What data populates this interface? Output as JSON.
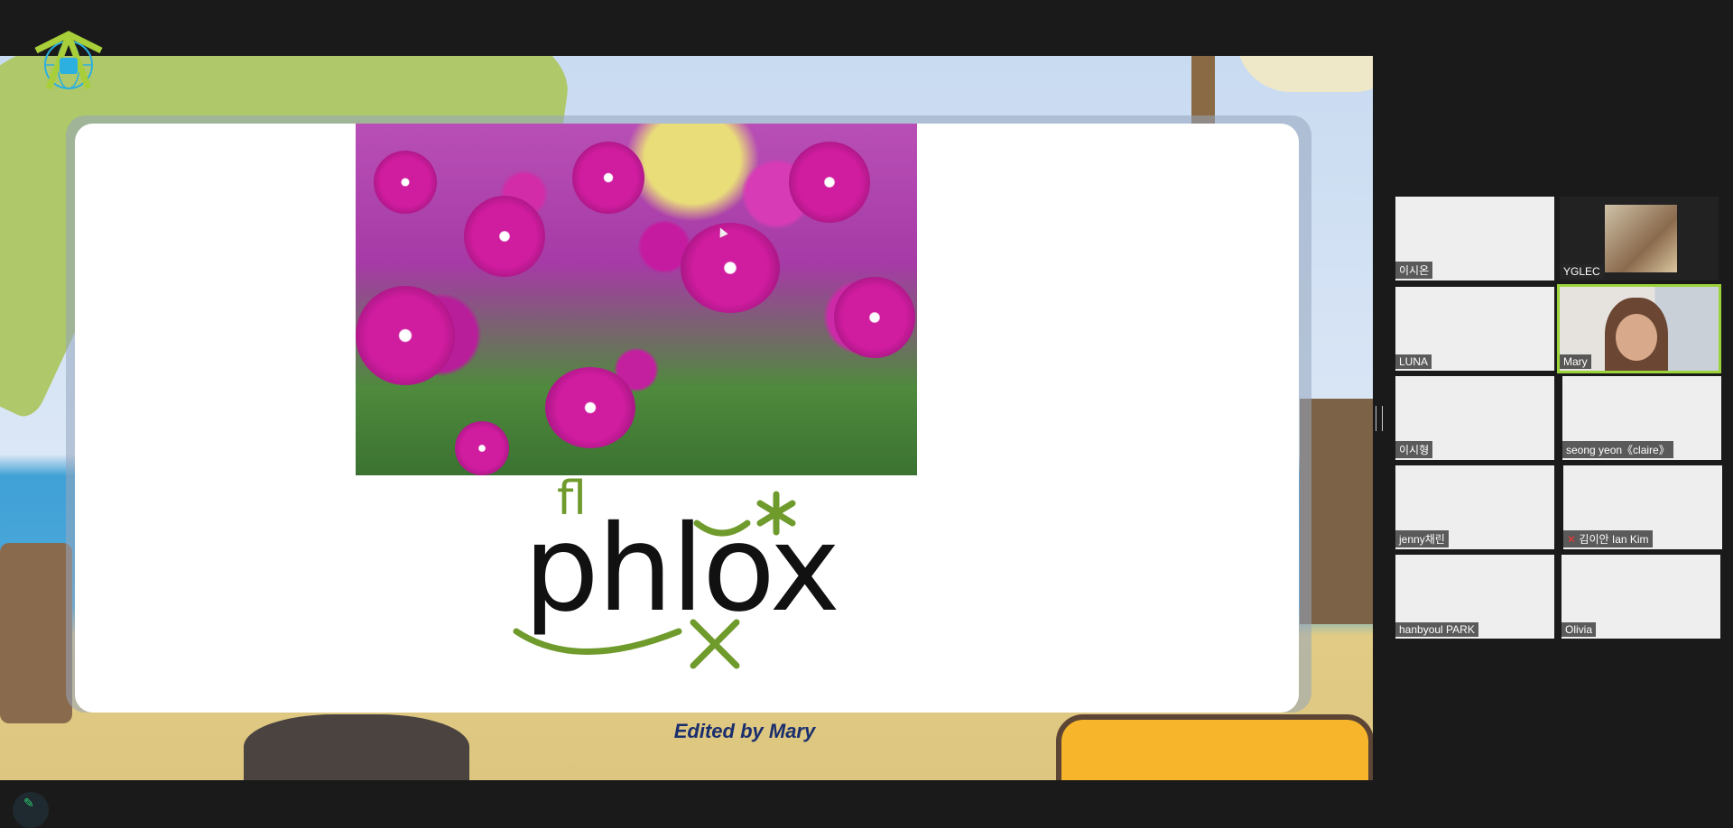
{
  "share_screen": {
    "slide": {
      "image_alt": "purple phlox flowers",
      "word": "phlox",
      "sound_hint": "fl",
      "caption": "Edited by Mary"
    },
    "company_logo": "globe-e-logo-icon"
  },
  "colors": {
    "accent_green": "#6f9a2c",
    "active_speaker": "#9bd33a",
    "caption": "#1a2e6e",
    "background": "#1a1a1a"
  },
  "gallery": {
    "participants": [
      {
        "name": "이시온",
        "video": false
      },
      {
        "name": "YGLEC",
        "video": true
      },
      {
        "name": "LUNA",
        "video": false
      },
      {
        "name": "Mary",
        "video": true,
        "active_speaker": true
      },
      {
        "name": "이시형",
        "video": false
      },
      {
        "name": "seong yeon《claire》",
        "video": false
      },
      {
        "name": "jenny채린",
        "video": false
      },
      {
        "name": "김이안 Ian Kim",
        "video": false,
        "muted": true
      },
      {
        "name": "hanbyoul PARK",
        "video": false
      },
      {
        "name": "Olivia",
        "video": false
      }
    ]
  }
}
